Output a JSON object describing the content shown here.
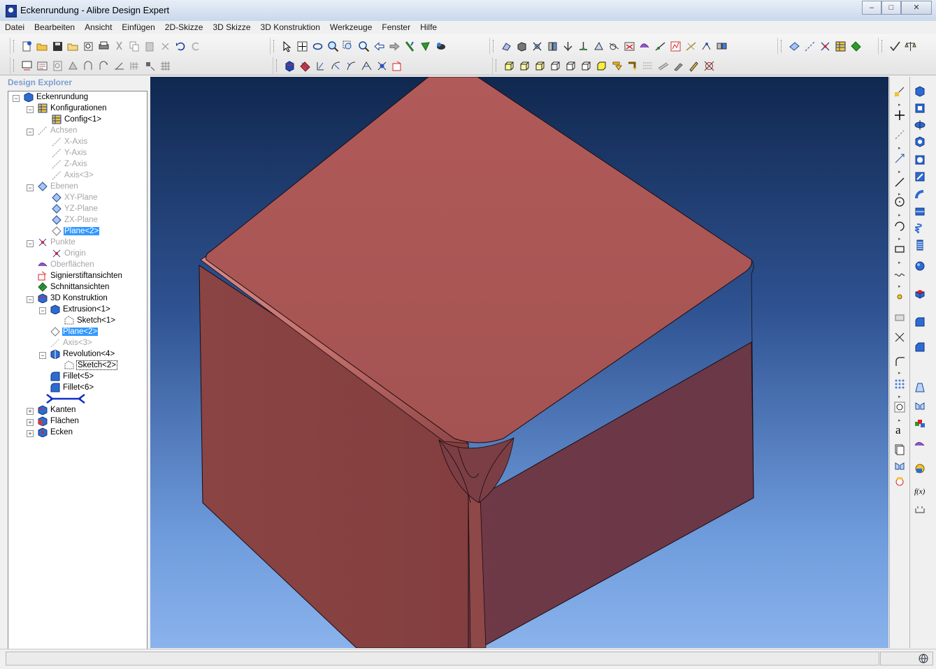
{
  "window": {
    "title": "Eckenrundung - Alibre Design Expert",
    "minimize": "–",
    "maximize": "□",
    "close": "✕"
  },
  "menu": [
    "Datei",
    "Bearbeiten",
    "Ansicht",
    "Einfügen",
    "2D-Skizze",
    "3D Skizze",
    "3D Konstruktion",
    "Werkzeuge",
    "Fenster",
    "Hilfe"
  ],
  "explorer": {
    "title": "Design Explorer",
    "nodes": [
      {
        "label": "Eckenrundung",
        "icon": "part-icon"
      },
      {
        "label": "Konfigurationen",
        "icon": "configurations-icon"
      },
      {
        "label": "Config<1>",
        "icon": "config-icon"
      },
      {
        "label": "Achsen",
        "icon": "axis-icon"
      },
      {
        "label": "X-Axis",
        "icon": "axis-icon"
      },
      {
        "label": "Y-Axis",
        "icon": "axis-icon"
      },
      {
        "label": "Z-Axis",
        "icon": "axis-icon"
      },
      {
        "label": "Axis<3>",
        "icon": "axis-icon"
      },
      {
        "label": "Ebenen",
        "icon": "plane-icon"
      },
      {
        "label": "XY-Plane",
        "icon": "plane-icon"
      },
      {
        "label": "YZ-Plane",
        "icon": "plane-icon"
      },
      {
        "label": "ZX-Plane",
        "icon": "plane-icon"
      },
      {
        "label": "Plane<2>",
        "icon": "plane-icon"
      },
      {
        "label": "Punkte",
        "icon": "point-icon"
      },
      {
        "label": "Origin",
        "icon": "point-icon"
      },
      {
        "label": "Oberflächen",
        "icon": "surface-icon"
      },
      {
        "label": "Signierstiftansichten",
        "icon": "redline-icon"
      },
      {
        "label": "Schnittansichten",
        "icon": "section-icon"
      },
      {
        "label": "3D Konstruktion",
        "icon": "design-icon"
      },
      {
        "label": "Extrusion<1>",
        "icon": "extrude-icon"
      },
      {
        "label": "Sketch<1>",
        "icon": "sketch-icon"
      },
      {
        "label": "Plane<2>",
        "icon": "plane-icon"
      },
      {
        "label": "Axis<3>",
        "icon": "axis-icon"
      },
      {
        "label": "Revolution<4>",
        "icon": "revolve-icon"
      },
      {
        "label": "Sketch<2>",
        "icon": "sketch-icon"
      },
      {
        "label": "Fillet<5>",
        "icon": "fillet-icon"
      },
      {
        "label": "Fillet<6>",
        "icon": "fillet-icon"
      },
      {
        "label": "",
        "icon": "rollback-marker-icon"
      },
      {
        "label": "Kanten",
        "icon": "edges-icon"
      },
      {
        "label": "Flächen",
        "icon": "faces-icon"
      },
      {
        "label": "Ecken",
        "icon": "vertices-icon"
      }
    ]
  },
  "expanders": {
    "open": "−",
    "closed": "+"
  },
  "colors": {
    "model_top": "#a95555",
    "model_left": "#88403f",
    "model_right": "#703a47",
    "selection": "#3399ff"
  }
}
